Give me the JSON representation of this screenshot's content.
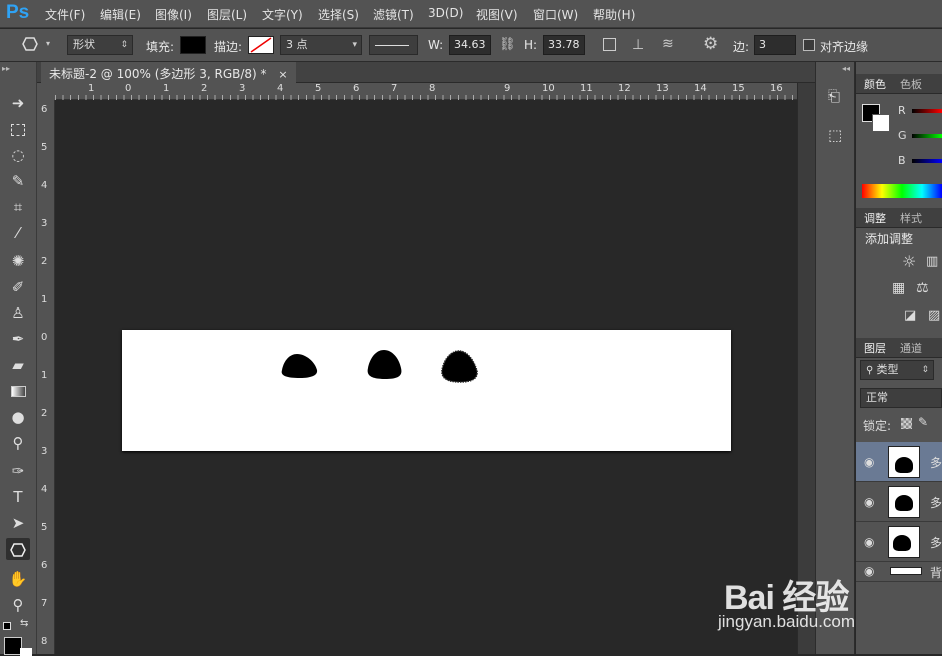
{
  "app": {
    "logo": "Ps"
  },
  "menu": [
    "文件(F)",
    "编辑(E)",
    "图像(I)",
    "图层(L)",
    "文字(Y)",
    "选择(S)",
    "滤镜(T)",
    "3D(D)",
    "视图(V)",
    "窗口(W)",
    "帮助(H)"
  ],
  "options": {
    "mode": "形状",
    "fill_label": "填充:",
    "stroke_label": "描边:",
    "stroke_width": "3 点",
    "w_label": "W:",
    "w_value": "34.63",
    "h_label": "H:",
    "h_value": "33.78",
    "sides_label": "边:",
    "sides_value": "3",
    "align_edges_label": "对齐边缘"
  },
  "document": {
    "tab_title": "未标题-2 @ 100% (多边形 3, RGB/8) *",
    "close": "×"
  },
  "ruler": {
    "h": [
      "1",
      "0",
      "1",
      "2",
      "3",
      "4",
      "5",
      "6",
      "7",
      "8",
      "9",
      "10",
      "11",
      "12",
      "13",
      "14",
      "15",
      "16",
      "17"
    ],
    "v": [
      "6",
      "5",
      "4",
      "3",
      "2",
      "1",
      "0",
      "1",
      "2",
      "3",
      "4",
      "5",
      "6",
      "7",
      "8"
    ]
  },
  "panels": {
    "color": {
      "tabs": [
        "颜色",
        "色板"
      ],
      "channels": [
        "R",
        "G",
        "B"
      ]
    },
    "adjust": {
      "tabs": [
        "调整",
        "样式"
      ],
      "heading": "添加调整"
    },
    "layers": {
      "tabs": [
        "图层",
        "通道"
      ],
      "filter": "类型",
      "blend": "正常",
      "lock_label": "锁定:",
      "rows": [
        {
          "name": "多"
        },
        {
          "name": "多"
        },
        {
          "name": "多"
        },
        {
          "name": "背"
        }
      ]
    }
  },
  "watermark": {
    "logo": "Bai 经验",
    "url": "jingyan.baidu.com"
  }
}
